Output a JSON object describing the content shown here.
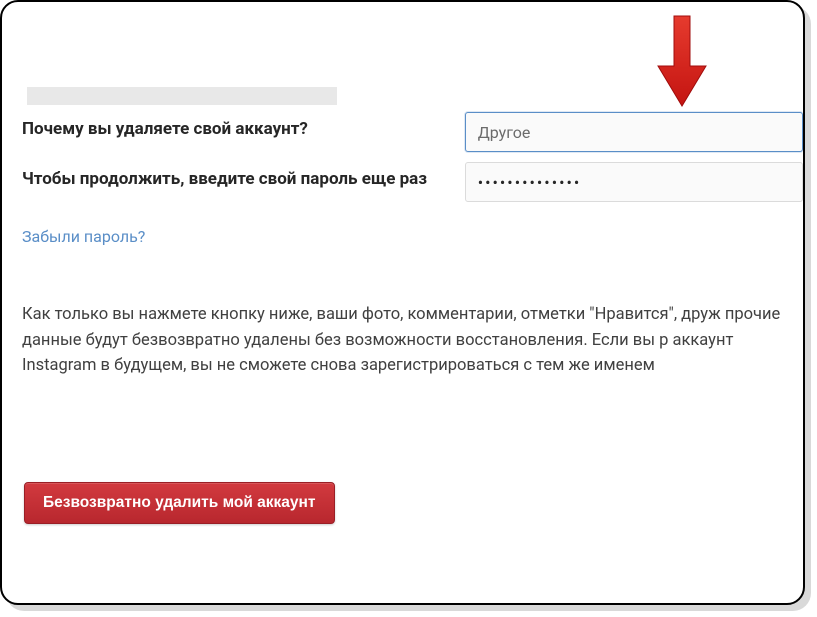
{
  "top_fade_text": "",
  "form": {
    "reason_label": "Почему вы удаляете свой аккаунт?",
    "reason_value": "Другое",
    "password_label": "Чтобы продолжить, введите свой пароль еще раз",
    "password_value": "••••••••••••••",
    "forgot_password": "Забыли пароль?"
  },
  "warning": "Как только вы нажмете кнопку ниже, ваши фото, комментарии, отметки \"Нравится\", друж прочие данные будут безвозвратно удалены без возможности восстановления. Если вы р аккаунт Instagram в будущем, вы не сможете снова зарегистрироваться с тем же именем",
  "delete_button": "Безвозвратно удалить мой аккаунт"
}
